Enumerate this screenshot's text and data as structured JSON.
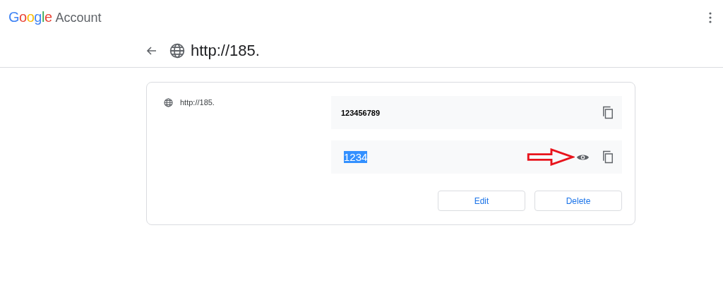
{
  "header": {
    "logo": "Google",
    "product": "Account"
  },
  "title_bar": {
    "title": "http://185."
  },
  "card": {
    "site": "http://185.",
    "fields": [
      {
        "kind": "username",
        "value": "123456789",
        "selected": false
      },
      {
        "kind": "password",
        "value": "1234",
        "selected": true
      }
    ],
    "buttons": [
      "Edit",
      "Delete"
    ]
  }
}
